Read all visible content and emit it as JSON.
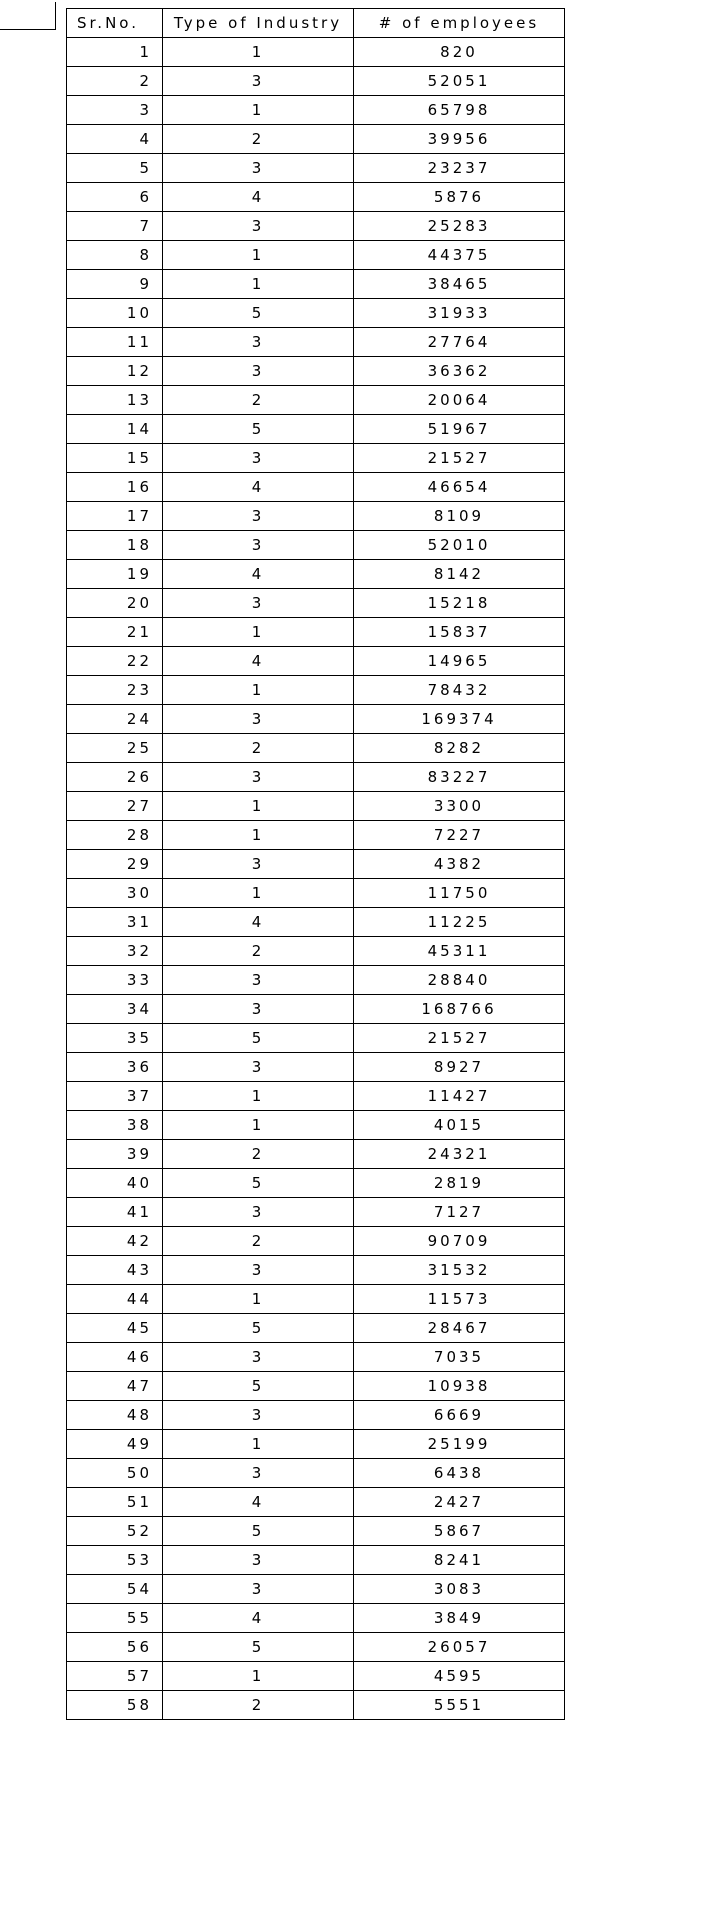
{
  "chart_data": {
    "type": "table",
    "columns": [
      "Sr.No.",
      "Type of Industry",
      "# of employees"
    ],
    "rows": [
      [
        1,
        1,
        820
      ],
      [
        2,
        3,
        52051
      ],
      [
        3,
        1,
        65798
      ],
      [
        4,
        2,
        39956
      ],
      [
        5,
        3,
        23237
      ],
      [
        6,
        4,
        5876
      ],
      [
        7,
        3,
        25283
      ],
      [
        8,
        1,
        44375
      ],
      [
        9,
        1,
        38465
      ],
      [
        10,
        5,
        31933
      ],
      [
        11,
        3,
        27764
      ],
      [
        12,
        3,
        36362
      ],
      [
        13,
        2,
        20064
      ],
      [
        14,
        5,
        51967
      ],
      [
        15,
        3,
        21527
      ],
      [
        16,
        4,
        46654
      ],
      [
        17,
        3,
        8109
      ],
      [
        18,
        3,
        52010
      ],
      [
        19,
        4,
        8142
      ],
      [
        20,
        3,
        15218
      ],
      [
        21,
        1,
        15837
      ],
      [
        22,
        4,
        14965
      ],
      [
        23,
        1,
        78432
      ],
      [
        24,
        3,
        169374
      ],
      [
        25,
        2,
        8282
      ],
      [
        26,
        3,
        83227
      ],
      [
        27,
        1,
        3300
      ],
      [
        28,
        1,
        7227
      ],
      [
        29,
        3,
        4382
      ],
      [
        30,
        1,
        11750
      ],
      [
        31,
        4,
        11225
      ],
      [
        32,
        2,
        45311
      ],
      [
        33,
        3,
        28840
      ],
      [
        34,
        3,
        168766
      ],
      [
        35,
        5,
        21527
      ],
      [
        36,
        3,
        8927
      ],
      [
        37,
        1,
        11427
      ],
      [
        38,
        1,
        4015
      ],
      [
        39,
        2,
        24321
      ],
      [
        40,
        5,
        2819
      ],
      [
        41,
        3,
        7127
      ],
      [
        42,
        2,
        90709
      ],
      [
        43,
        3,
        31532
      ],
      [
        44,
        1,
        11573
      ],
      [
        45,
        5,
        28467
      ],
      [
        46,
        3,
        7035
      ],
      [
        47,
        5,
        10938
      ],
      [
        48,
        3,
        6669
      ],
      [
        49,
        1,
        25199
      ],
      [
        50,
        3,
        6438
      ],
      [
        51,
        4,
        2427
      ],
      [
        52,
        5,
        5867
      ],
      [
        53,
        3,
        8241
      ],
      [
        54,
        3,
        3083
      ],
      [
        55,
        4,
        3849
      ],
      [
        56,
        5,
        26057
      ],
      [
        57,
        1,
        4595
      ],
      [
        58,
        2,
        5551
      ]
    ]
  }
}
